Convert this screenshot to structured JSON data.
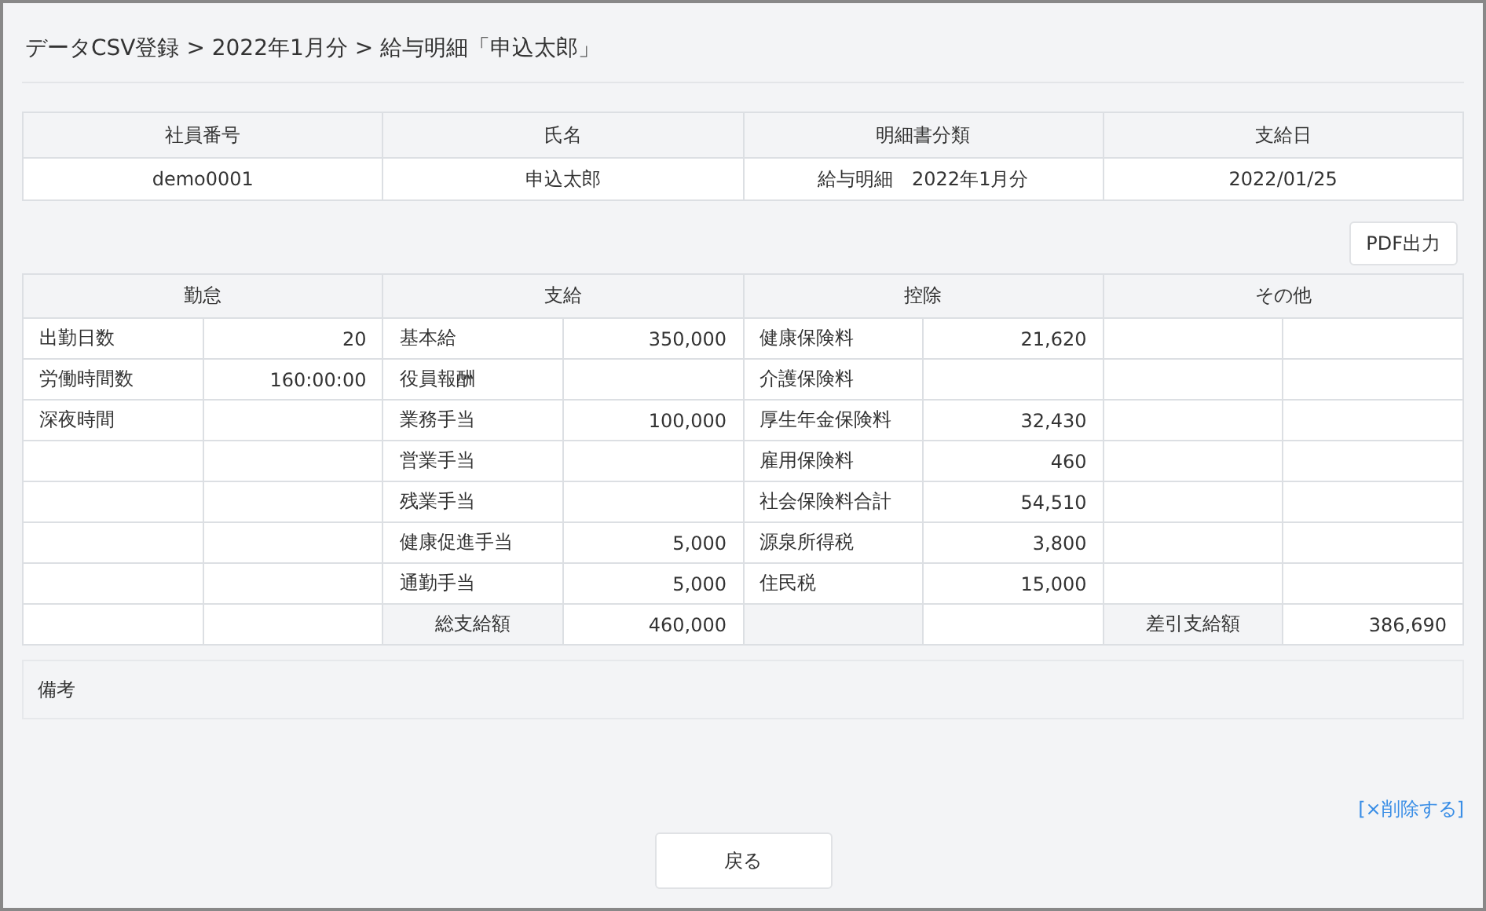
{
  "breadcrumb": "データCSV登録 > 2022年1月分 > 給与明細「申込太郎」",
  "summary": {
    "columns": [
      "社員番号",
      "氏名",
      "明細書分類",
      "支給日"
    ],
    "values": [
      "demo0001",
      "申込太郎",
      "給与明細　2022年1月分",
      "2022/01/25"
    ]
  },
  "pdf_button": "PDF出力",
  "groups": [
    {
      "title": "勤怠",
      "rows": [
        {
          "kind": "item",
          "label": "出勤日数",
          "value": "20"
        },
        {
          "kind": "item",
          "label": "労働時間数",
          "value": "160:00:00"
        },
        {
          "kind": "item",
          "label": "深夜時間"
        },
        {
          "kind": "item"
        },
        {
          "kind": "item"
        },
        {
          "kind": "item"
        },
        {
          "kind": "item"
        },
        {
          "kind": "item"
        }
      ]
    },
    {
      "title": "支給",
      "rows": [
        {
          "kind": "item",
          "label": "基本給",
          "value": "350,000"
        },
        {
          "kind": "item",
          "label": "役員報酬"
        },
        {
          "kind": "item",
          "label": "業務手当",
          "value": "100,000"
        },
        {
          "kind": "item",
          "label": "営業手当"
        },
        {
          "kind": "item",
          "label": "残業手当"
        },
        {
          "kind": "item",
          "label": "健康促進手当",
          "value": "5,000"
        },
        {
          "kind": "item",
          "label": "通勤手当",
          "value": "5,000"
        },
        {
          "kind": "total",
          "label": "総支給額",
          "value": "460,000"
        }
      ]
    },
    {
      "title": "控除",
      "rows": [
        {
          "kind": "item",
          "label": "健康保険料",
          "value": "21,620"
        },
        {
          "kind": "item",
          "label": "介護保険料"
        },
        {
          "kind": "item",
          "label": "厚生年金保険料",
          "value": "32,430"
        },
        {
          "kind": "item",
          "label": "雇用保険料",
          "value": "460"
        },
        {
          "kind": "item",
          "label": "社会保険料合計",
          "value": "54,510"
        },
        {
          "kind": "item",
          "label": "源泉所得税",
          "value": "3,800"
        },
        {
          "kind": "item",
          "label": "住民税",
          "value": "15,000"
        },
        {
          "kind": "total"
        }
      ]
    },
    {
      "title": "その他",
      "rows": [
        {
          "kind": "item"
        },
        {
          "kind": "item"
        },
        {
          "kind": "item"
        },
        {
          "kind": "item"
        },
        {
          "kind": "item"
        },
        {
          "kind": "item"
        },
        {
          "kind": "item"
        },
        {
          "kind": "total",
          "label": "差引支給額",
          "value": "386,690"
        }
      ]
    }
  ],
  "remarks_label": "備考",
  "delete_link": "[×削除する]",
  "back_button": "戻る"
}
